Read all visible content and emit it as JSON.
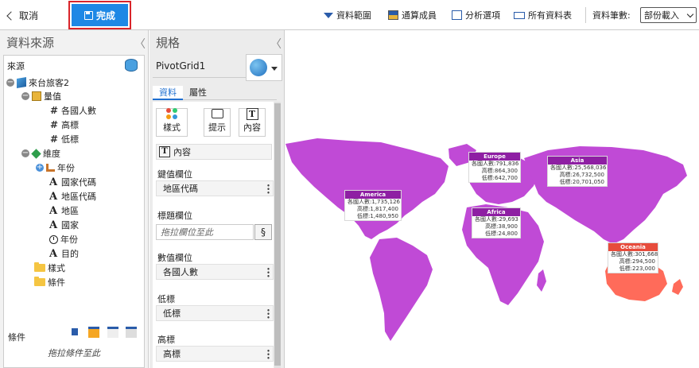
{
  "toolbar": {
    "cancel_label": "取消",
    "done_label": "完成",
    "data_range_label": "資料範圍",
    "calc_member_label": "通算成員",
    "analysis_options_label": "分析選項",
    "all_tables_label": "所有資料表",
    "data_count_label": "資料筆數:",
    "data_count_value": "部份載入"
  },
  "left_panel": {
    "title": "資料來源",
    "source_label": "來源",
    "tree": {
      "root": "來台旅客2",
      "measures_group": "量值",
      "measures": [
        "各國人數",
        "高標",
        "低標"
      ],
      "dimensions_group": "維度",
      "dimensions": [
        {
          "label": "年份",
          "icon": "hierarchy-icon"
        },
        {
          "label": "國家代碼",
          "icon": "text-field-icon"
        },
        {
          "label": "地區代碼",
          "icon": "text-field-icon"
        },
        {
          "label": "地區",
          "icon": "text-field-icon"
        },
        {
          "label": "國家",
          "icon": "text-field-icon"
        },
        {
          "label": "年份",
          "icon": "clock-icon"
        },
        {
          "label": "目的",
          "icon": "text-field-icon"
        }
      ],
      "folders": [
        "樣式",
        "條件"
      ]
    },
    "conditions_label": "條件",
    "conditions_hint": "拖拉條件至此"
  },
  "mid_panel": {
    "title": "規格",
    "component_name": "PivotGrid1",
    "tabs": [
      "資料",
      "屬性"
    ],
    "format_buttons": [
      "樣式",
      "提示",
      "內容"
    ],
    "content_row": "內容",
    "key_field_label": "鍵值欄位",
    "key_field_value": "地區代碼",
    "title_field_label": "標題欄位",
    "title_field_placeholder": "拖拉欄位至此",
    "value_field_label": "數值欄位",
    "value_field_value": "各國人數",
    "low_label": "低標",
    "low_value": "低標",
    "high_label": "高標",
    "high_value": "高標"
  },
  "map": {
    "colors": {
      "region": "#c04ad6",
      "oceania": "#ff6b5a",
      "label_header": "#8e1fa3"
    },
    "regions": [
      {
        "name": "Europe",
        "lines": [
          "各國人數:791,836",
          "高標:864,300",
          "低標:642,700"
        ]
      },
      {
        "name": "Asia",
        "lines": [
          "各國人數:25,568,036",
          "高標:26,732,500",
          "低標:20,701,050"
        ]
      },
      {
        "name": "America",
        "lines": [
          "各國人數:1,735,126",
          "高標:1,817,400",
          "低標:1,480,950"
        ]
      },
      {
        "name": "Africa",
        "lines": [
          "各國人數:29,693",
          "高標:38,900",
          "低標:24,800"
        ]
      },
      {
        "name": "Oceania",
        "lines": [
          "各國人數:301,668",
          "高標:294,500",
          "低標:223,000"
        ]
      }
    ]
  }
}
